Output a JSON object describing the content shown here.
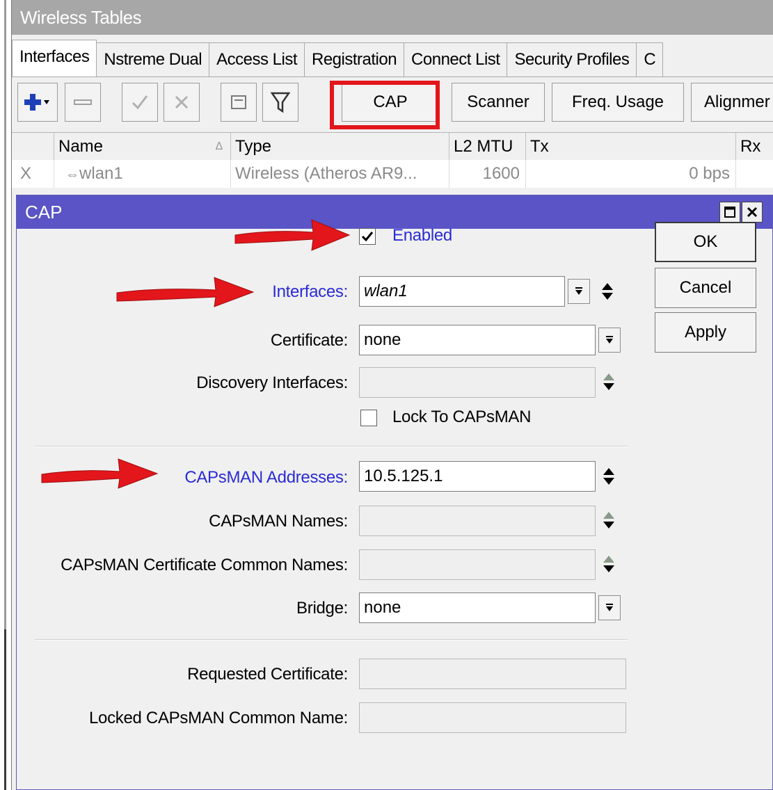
{
  "window": {
    "title": "Wireless Tables"
  },
  "tabs": [
    "Interfaces",
    "Nstreme Dual",
    "Access List",
    "Registration",
    "Connect List",
    "Security Profiles",
    "C"
  ],
  "toolbar": {
    "buttons": [
      "CAP",
      "Scanner",
      "Freq. Usage",
      "Alignmer"
    ]
  },
  "table": {
    "columns": [
      "Name",
      "Type",
      "L2 MTU",
      "Tx",
      "Rx"
    ],
    "rows": [
      {
        "flag": "X",
        "name": "wlan1",
        "type": "Wireless (Atheros AR9...",
        "l2mtu": "1600",
        "tx": "0 bps"
      }
    ]
  },
  "dialog": {
    "title": "CAP",
    "fields": {
      "enabled_label": "Enabled",
      "enabled": true,
      "interfaces_label": "Interfaces:",
      "interfaces_value": "wlan1",
      "certificate_label": "Certificate:",
      "certificate_value": "none",
      "discovery_label": "Discovery Interfaces:",
      "discovery_value": "",
      "lock_label": "Lock To CAPsMAN",
      "lock_checked": false,
      "capsman_addresses_label": "CAPsMAN Addresses:",
      "capsman_addresses_value": "10.5.125.1",
      "capsman_names_label": "CAPsMAN Names:",
      "capsman_names_value": "",
      "capsman_cert_label": "CAPsMAN Certificate Common Names:",
      "capsman_cert_value": "",
      "bridge_label": "Bridge:",
      "bridge_value": "none",
      "requested_cert_label": "Requested Certificate:",
      "requested_cert_value": "",
      "locked_name_label": "Locked CAPsMAN Common Name:",
      "locked_name_value": ""
    },
    "buttons": {
      "ok": "OK",
      "cancel": "Cancel",
      "apply": "Apply"
    }
  },
  "colors": {
    "dialog_title_bar": "#5a54c6",
    "highlight_label": "#2b2bd6",
    "annotation_red": "#e3161c"
  },
  "icons": [
    "plus-icon",
    "minus-icon",
    "check-icon",
    "cross-icon",
    "comment-icon",
    "filter-icon",
    "wireless-interface-icon",
    "dropdown-arrow-icon",
    "updown-arrows-icon",
    "maximize-icon",
    "close-icon"
  ]
}
